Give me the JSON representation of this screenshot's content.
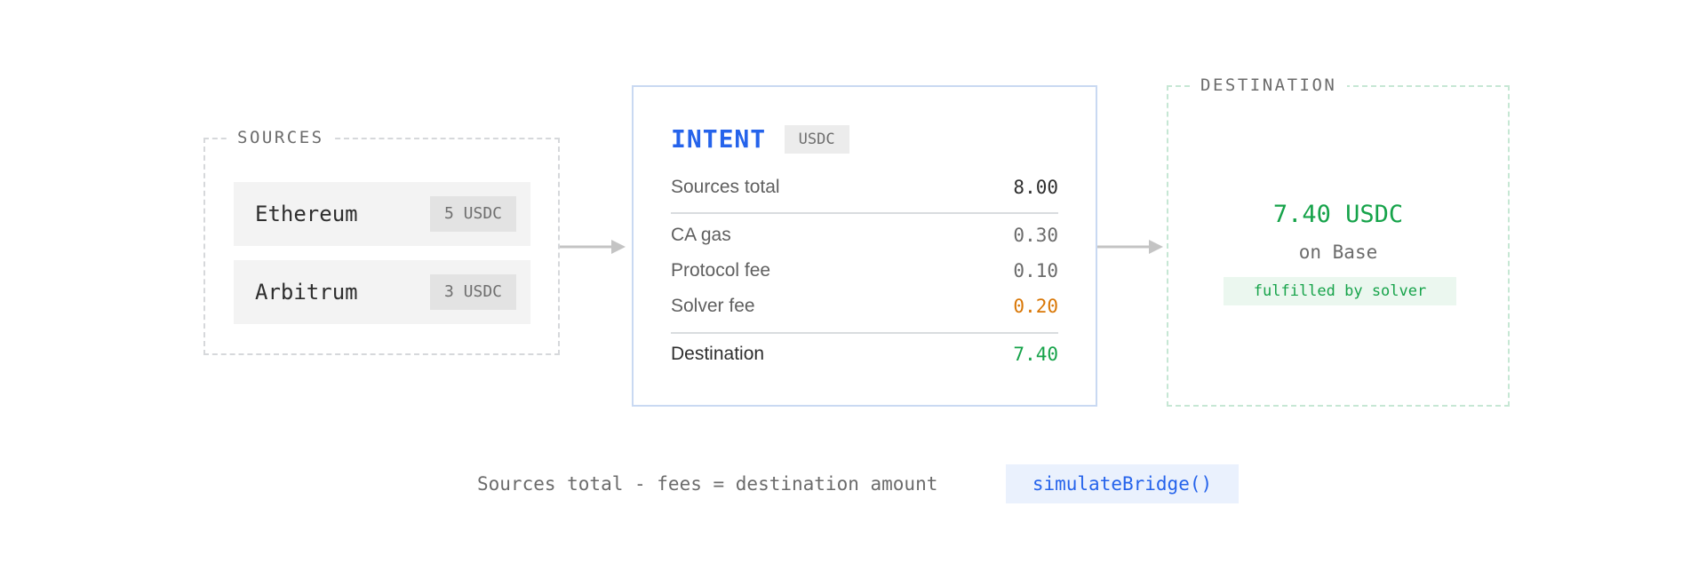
{
  "sources": {
    "title": "SOURCES",
    "items": [
      {
        "chain": "Ethereum",
        "amount": "5 USDC"
      },
      {
        "chain": "Arbitrum",
        "amount": "3 USDC"
      }
    ]
  },
  "intent": {
    "title": "INTENT",
    "token": "USDC",
    "rows": {
      "sources_total": {
        "label": "Sources total",
        "value": "8.00"
      },
      "ca_gas": {
        "label": "CA gas",
        "value": "0.30"
      },
      "protocol_fee": {
        "label": "Protocol fee",
        "value": "0.10"
      },
      "solver_fee": {
        "label": "Solver fee",
        "value": "0.20"
      },
      "destination": {
        "label": "Destination",
        "value": "7.40"
      }
    }
  },
  "destination": {
    "title": "DESTINATION",
    "amount": "7.40 USDC",
    "chain": "on Base",
    "badge": "fulfilled by solver"
  },
  "footer": {
    "formula": "Sources total - fees = destination amount",
    "function": "simulateBridge()"
  },
  "colors": {
    "accent_blue": "#2563eb",
    "fee_orange": "#d97706",
    "success_green": "#16a34a",
    "source_border": "#d6d8db",
    "destination_border": "#c6e7d4",
    "intent_border": "#c9d9f2"
  }
}
